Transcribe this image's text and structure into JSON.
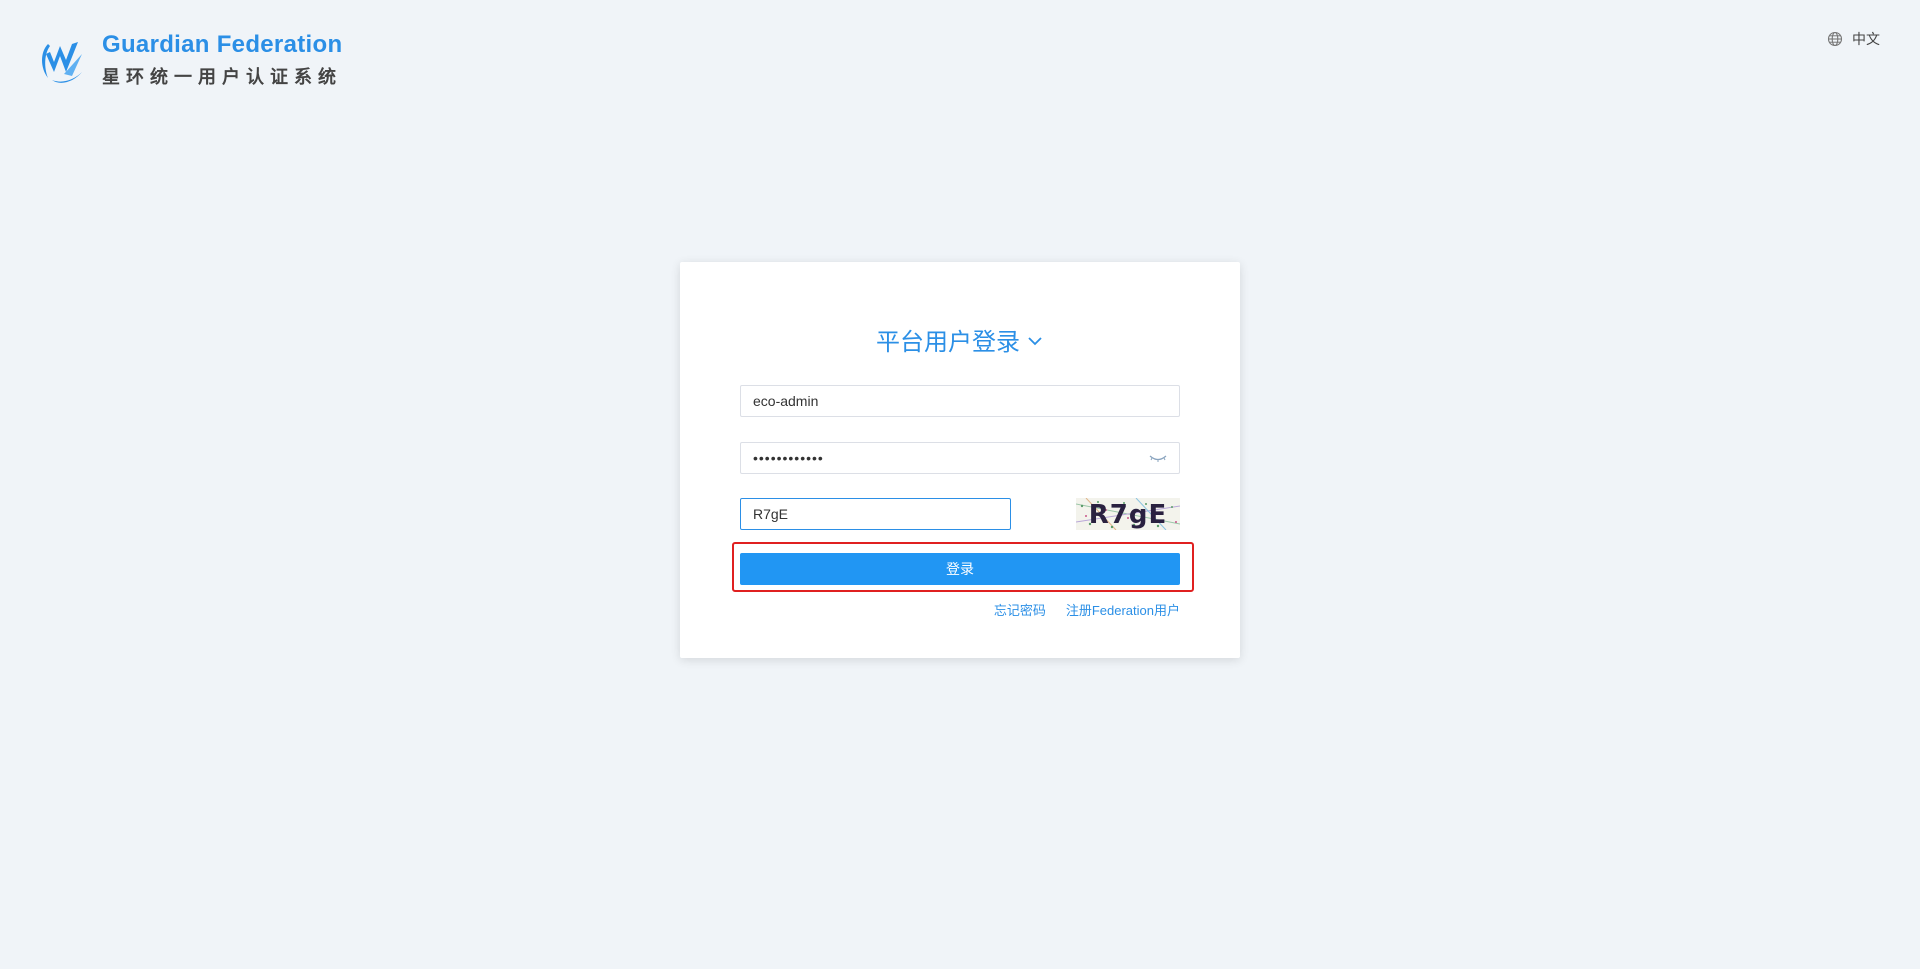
{
  "header": {
    "logo_title": "Guardian Federation",
    "logo_subtitle": "星环统一用户认证系统",
    "logo_icon": "guardian-logo-icon",
    "language_label": "中文",
    "language_icon": "globe-icon"
  },
  "login": {
    "title": "平台用户登录",
    "title_dropdown_icon": "chevron-down-icon",
    "username_value": "eco-admin",
    "password_masked": "••••••••••••",
    "password_toggle_icon": "eye-closed-icon",
    "captcha_value": "R7gE",
    "captcha_image_text": "R7gE",
    "submit_label": "登录",
    "forgot_password_label": "忘记密码",
    "register_label": "注册Federation用户"
  },
  "colors": {
    "brand_blue": "#2b8fe6",
    "button_blue": "#2196f3",
    "highlight_red": "#e02020",
    "background": "#f0f4f8"
  }
}
